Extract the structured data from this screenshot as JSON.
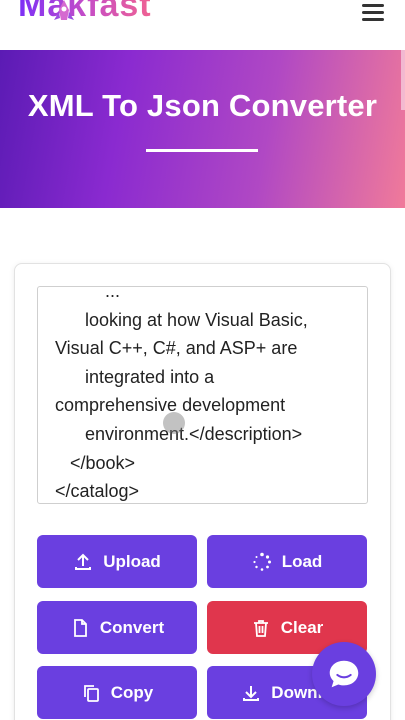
{
  "brand": {
    "name": "Makfast"
  },
  "header": {
    "menu_icon": "hamburger-icon"
  },
  "hero": {
    "title": "XML To Json Converter"
  },
  "editor": {
    "content": "          ...\n      looking at how Visual Basic,\nVisual C++, C#, and ASP+ are\n      integrated into a\ncomprehensive development\n      environment.</description>\n   </book>\n</catalog>"
  },
  "buttons": {
    "upload": "Upload",
    "load": "Load",
    "convert": "Convert",
    "clear": "Clear",
    "copy": "Copy",
    "download": "Downlo"
  },
  "colors": {
    "primary": "#6a3fe0",
    "danger": "#e0364d"
  }
}
